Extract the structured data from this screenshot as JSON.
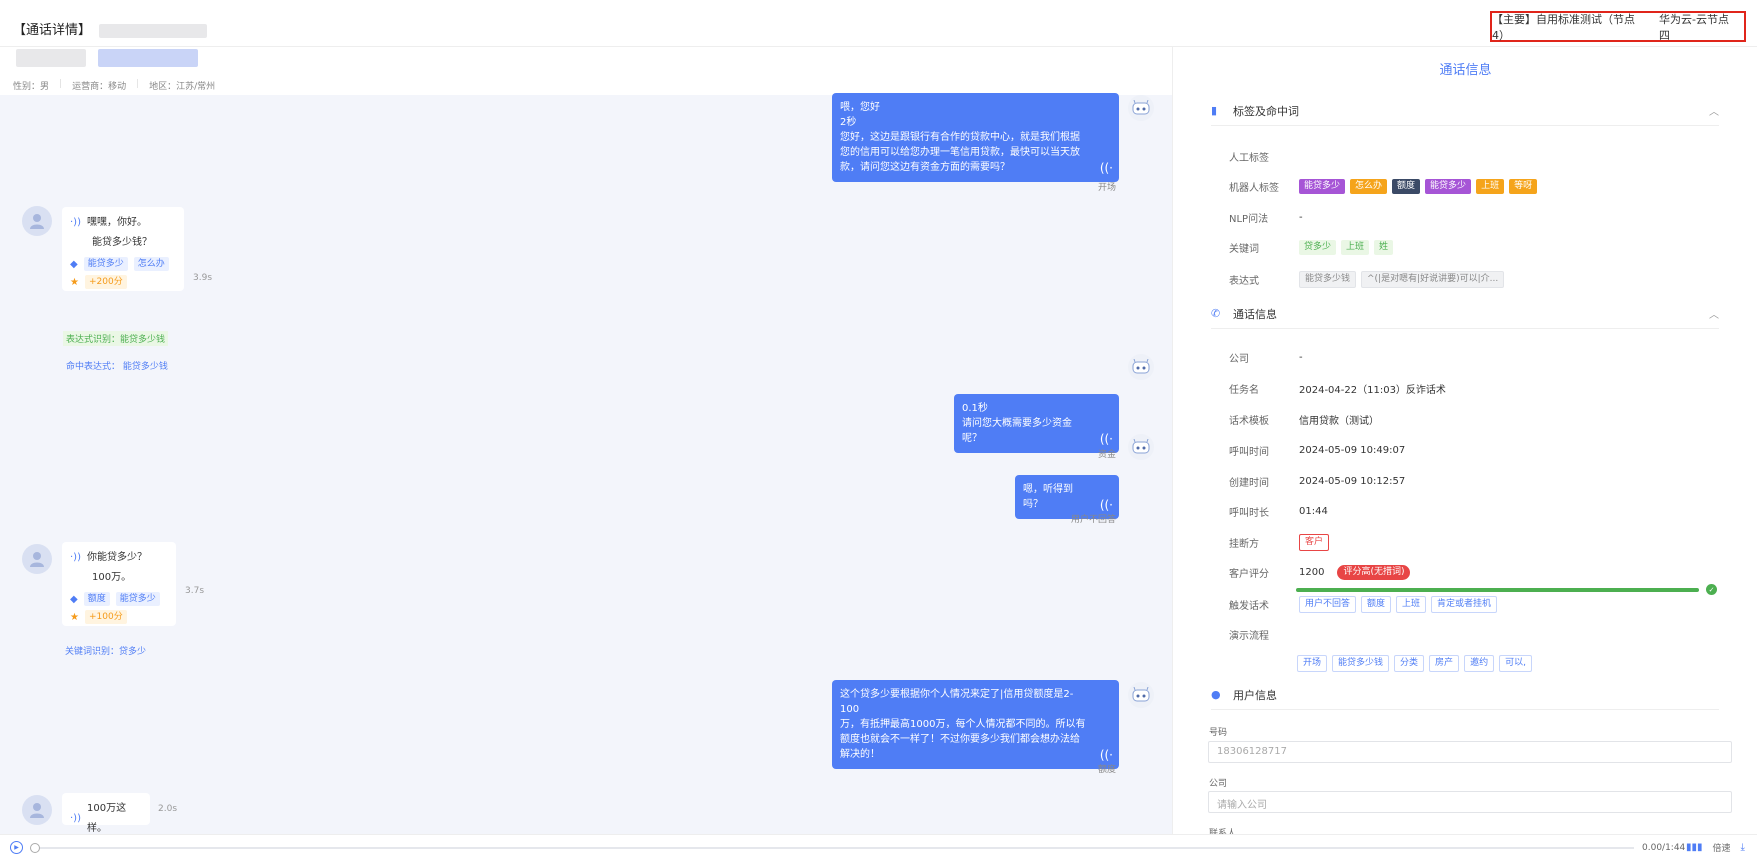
{
  "header": {
    "title": "【通话详情】",
    "node_label": "【主要】自用标准测试（节点4）",
    "node_cloud": "华为云-云节点四"
  },
  "user_meta": {
    "gender": "性别：男",
    "carrier": "运营商：移动",
    "region": "地区：江苏/常州"
  },
  "chat": {
    "m1": {
      "lines": [
        "喂，您好",
        "2秒",
        "您好，这边是跟银行有合作的贷款中心，就是我们根据",
        "您的信用可以给您办理一笔信用贷款，最快可以当天放",
        "款，请问您这边有资金方面的需要吗？"
      ],
      "caption": "开场"
    },
    "u1": {
      "line1": "嘿嘿，你好。",
      "line2": "能贷多少钱？",
      "tag1": "能贷多少",
      "tag2": "怎么办",
      "score": "+200分",
      "duration": "3.9s",
      "note_green": "表达式识别：能贷多少钱",
      "note_blue": "命中表达式： 能贷多少钱"
    },
    "m2": {
      "lines": [
        "0.1秒",
        "请问您大概需要多少资金呢？"
      ],
      "caption": "资金"
    },
    "m3": {
      "lines": [
        "嗯，听得到吗？"
      ],
      "caption": "用户不回答"
    },
    "u2": {
      "line1": "你能贷多少？",
      "line2": "100万。",
      "tag1": "额度",
      "tag2": "能贷多少",
      "score": "+100分",
      "duration": "3.7s",
      "note_blue": "关键词识别：贷多少"
    },
    "m4": {
      "lines": [
        "这个贷多少要根据你个人情况来定了|信用贷额度是2-100",
        "万，有抵押最高1000万，每个人情况都不同的。所以有",
        "额度也就会不一样了！不过你要多少我们都会想办法给",
        "解决的！"
      ],
      "caption": "额度"
    },
    "u3": {
      "line1": "100万这样。",
      "duration": "2.0s"
    }
  },
  "panel": {
    "title": "通话信息",
    "tags_section": "标签及命中词",
    "manual_label": "人工标签",
    "robot_label": "机器人标签",
    "robot_tags": [
      "能贷多少",
      "怎么办",
      "额度",
      "能贷多少",
      "上班",
      "等呀"
    ],
    "nlp_label": "NLP问法",
    "nlp_value": "-",
    "keyword_label": "关键词",
    "keywords": [
      "贷多少",
      "上班",
      "姓"
    ],
    "expr_label": "表达式",
    "exprs": [
      "能贷多少钱",
      "^(|是对嗯有|好说讲要)可以|介..."
    ],
    "call_section": "通话信息",
    "company_label": "公司",
    "company_value": "-",
    "task_label": "任务名",
    "task_value": "2024-04-22（11:03）反诈话术",
    "template_label": "话术模板",
    "template_value": "信用贷款（测试）",
    "call_time_label": "呼叫时间",
    "call_time_value": "2024-05-09 10:49:07",
    "create_time_label": "创建时间",
    "create_time_value": "2024-05-09 10:12:57",
    "duration_label": "呼叫时长",
    "duration_value": "01:44",
    "hangup_label": "挂断方",
    "hangup_value": "客户",
    "score_label": "客户评分",
    "score_value": "1200",
    "score_badge": "评分高(无措词)",
    "trigger_label": "触发话术",
    "triggers": [
      "用户不回答",
      "额度",
      "上班",
      "肯定或者挂机"
    ],
    "flow_label": "演示流程",
    "flow_progress": 1.0,
    "flow_steps": [
      "开场",
      "能贷多少钱",
      "分类",
      "房产",
      "邀约",
      "可以,"
    ],
    "user_section": "用户信息",
    "phone_label": "号码",
    "phone_value": "18306128717",
    "company2_label": "公司",
    "company2_placeholder": "请输入公司",
    "next_label": "联系人"
  },
  "player": {
    "time": "0.00/1:44",
    "speed": "倍速"
  }
}
